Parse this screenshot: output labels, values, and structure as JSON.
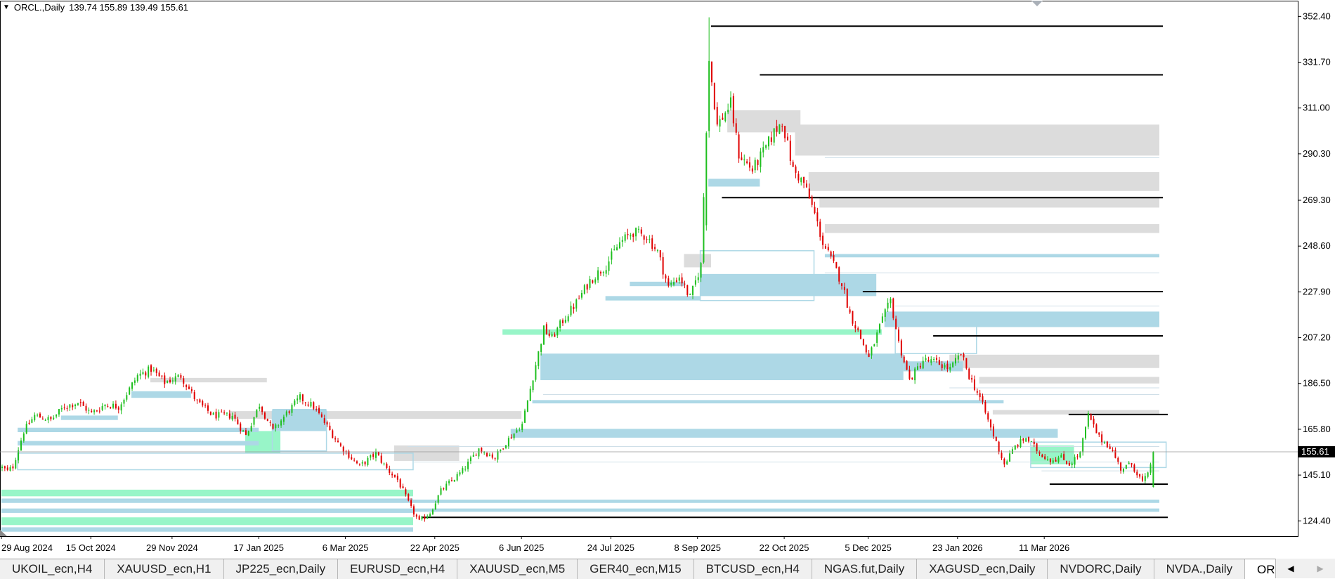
{
  "chart_header": {
    "symbol": "ORCL.,Daily",
    "ohlc": "139.74 155.89 139.49 155.61"
  },
  "tabs": [
    "UKOIL_ecn,H4",
    "XAUUSD_ecn,H1",
    "JP225_ecn,Daily",
    "EURUSD_ecn,H4",
    "XAUUSD_ecn,M5",
    "GER40_ecn,M15",
    "BTCUSD_ecn,H4",
    "NGAS.fut,Daily",
    "XAGUSD_ecn,Daily",
    "NVDORC,Daily",
    "NVDA.,Daily",
    "ORCL.,Daily"
  ],
  "active_tab": "ORCL.,Daily",
  "chart_data": {
    "type": "candlestick",
    "symbol": "ORCL.",
    "timeframe": "Daily",
    "last_price": 155.61,
    "ylim": [
      117.5,
      359.5
    ],
    "y_ticks": [
      352.4,
      331.7,
      311.0,
      290.3,
      269.3,
      248.6,
      227.9,
      207.2,
      186.5,
      165.8,
      145.1,
      124.4
    ],
    "x_tick_labels": [
      "29 Aug 2024",
      "15 Oct 2024",
      "29 Nov 2024",
      "17 Jan 2025",
      "6 Mar 2025",
      "22 Apr 2025",
      "6 Jun 2025",
      "24 Jul 2025",
      "8 Sep 2025",
      "22 Oct 2025",
      "5 Dec 2025",
      "23 Jan 2026",
      "11 Mar 2026"
    ],
    "price_path": [
      [
        0,
        148.5
      ],
      [
        2,
        146.8
      ],
      [
        4,
        149.0
      ],
      [
        8,
        165.0
      ],
      [
        12,
        172.0
      ],
      [
        18,
        170.0
      ],
      [
        23,
        176.0
      ],
      [
        28,
        178.0
      ],
      [
        33,
        173.0
      ],
      [
        38,
        177.0
      ],
      [
        43,
        176.0
      ],
      [
        50,
        190.0
      ],
      [
        55,
        193.0
      ],
      [
        60,
        187.0
      ],
      [
        66,
        190.0
      ],
      [
        72,
        178.0
      ],
      [
        78,
        172.0
      ],
      [
        85,
        172.0
      ],
      [
        90,
        163.0
      ],
      [
        95,
        177.0
      ],
      [
        100,
        165.0
      ],
      [
        105,
        173.0
      ],
      [
        110,
        180.0
      ],
      [
        115,
        176.0
      ],
      [
        125,
        158.0
      ],
      [
        132,
        149.0
      ],
      [
        138,
        155.0
      ],
      [
        142,
        148.0
      ],
      [
        146,
        143.0
      ],
      [
        151,
        130.0
      ],
      [
        154,
        124.0
      ],
      [
        158,
        128.0
      ],
      [
        162,
        138.0
      ],
      [
        170,
        147.0
      ],
      [
        176,
        157.0
      ],
      [
        182,
        153.0
      ],
      [
        186,
        160.0
      ],
      [
        192,
        168.0
      ],
      [
        197,
        195.0
      ],
      [
        200,
        211.0
      ],
      [
        203,
        207.0
      ],
      [
        207,
        215.0
      ],
      [
        212,
        223.0
      ],
      [
        217,
        233.0
      ],
      [
        223,
        240.0
      ],
      [
        228,
        250.0
      ],
      [
        233,
        255.0
      ],
      [
        238,
        253.0
      ],
      [
        242,
        246.0
      ],
      [
        246,
        230.0
      ],
      [
        250,
        235.0
      ],
      [
        254,
        225.0
      ],
      [
        258,
        240.0
      ],
      [
        261,
        333.0
      ],
      [
        264,
        303.0
      ],
      [
        269,
        313.0
      ],
      [
        272,
        290.0
      ],
      [
        277,
        283.0
      ],
      [
        281,
        291.0
      ],
      [
        285,
        300.0
      ],
      [
        288,
        305.0
      ],
      [
        292,
        283.0
      ],
      [
        296,
        277.0
      ],
      [
        300,
        263.0
      ],
      [
        303,
        250.0
      ],
      [
        307,
        240.0
      ],
      [
        310,
        232.0
      ],
      [
        313,
        218.0
      ],
      [
        316,
        210.0
      ],
      [
        320,
        198.0
      ],
      [
        324,
        212.0
      ],
      [
        328,
        224.0
      ],
      [
        331,
        205.0
      ],
      [
        335,
        188.0
      ],
      [
        340,
        197.0
      ],
      [
        345,
        196.0
      ],
      [
        350,
        193.0
      ],
      [
        354,
        200.0
      ],
      [
        357,
        190.0
      ],
      [
        361,
        180.0
      ],
      [
        366,
        163.0
      ],
      [
        370,
        150.0
      ],
      [
        374,
        158.0
      ],
      [
        378,
        162.0
      ],
      [
        383,
        155.0
      ],
      [
        387,
        152.0
      ],
      [
        391,
        153.0
      ],
      [
        394,
        150.0
      ],
      [
        398,
        155.0
      ],
      [
        401,
        172.0
      ],
      [
        405,
        162.0
      ],
      [
        409,
        158.0
      ],
      [
        413,
        148.0
      ],
      [
        417,
        150.0
      ],
      [
        421,
        142.0
      ],
      [
        423,
        145.0
      ],
      [
        425,
        155.6
      ]
    ],
    "horizontal_levels": [
      348.0,
      326.0,
      270.5,
      228.0,
      208.0,
      172.5,
      141.0,
      126.0
    ],
    "zone_colors": {
      "grey": "#dcdcdc",
      "blue": "#add8e6",
      "green": "#98f5c8",
      "bull_candle": "#1fbf1f",
      "bear_candle": "#e00000",
      "level_line": "#000000"
    }
  }
}
